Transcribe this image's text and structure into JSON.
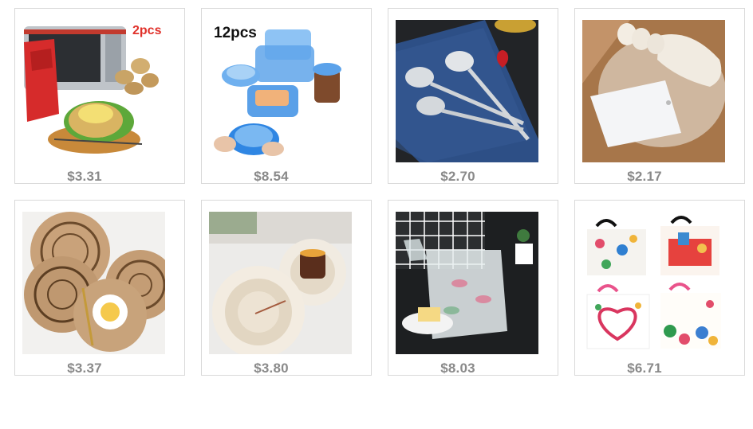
{
  "products": [
    {
      "price": "$3.31",
      "badge": "2pcs",
      "image": "microwave-potato-bag"
    },
    {
      "price": "$8.54",
      "badge": "12pcs",
      "image": "silicone-stretch-lids"
    },
    {
      "price": "$2.70",
      "image": "stainless-steel-spoons"
    },
    {
      "price": "$2.17",
      "image": "dough-scraper"
    },
    {
      "price": "$3.37",
      "image": "jute-placemats"
    },
    {
      "price": "$3.80",
      "image": "macrame-coasters"
    },
    {
      "price": "$8.03",
      "image": "plastic-dessert-bags"
    },
    {
      "price": "$6.71",
      "image": "printed-gift-bags"
    }
  ]
}
